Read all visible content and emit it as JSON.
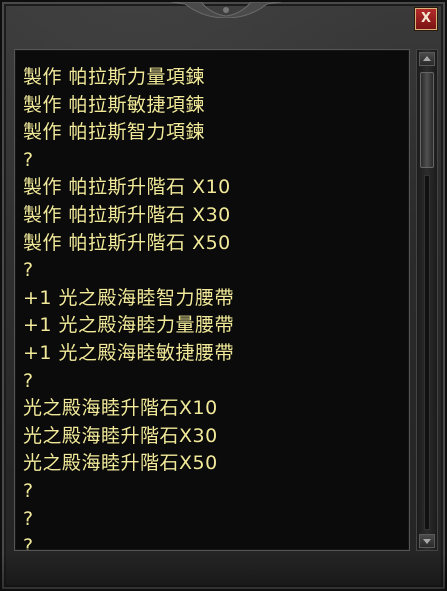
{
  "window": {
    "close_label": "X"
  },
  "items": [
    "製作 帕拉斯力量項鍊",
    "製作 帕拉斯敏捷項鍊",
    "製作 帕拉斯智力項鍊",
    "?",
    "製作 帕拉斯升階石 X10",
    "製作 帕拉斯升階石 X30",
    "製作 帕拉斯升階石 X50",
    "?",
    "+1 光之殿海睦智力腰帶",
    "+1 光之殿海睦力量腰帶",
    "+1 光之殿海睦敏捷腰帶",
    "?",
    "光之殿海睦升階石X10",
    "光之殿海睦升階石X30",
    "光之殿海睦升階石X50",
    "?",
    "?",
    "?"
  ],
  "colors": {
    "text": "#f2ea9a",
    "close_button": "#b52a2a",
    "panel_background": "#0b0b0b"
  },
  "icons": {
    "close": "close-icon",
    "ornament": "ornament-icon"
  }
}
